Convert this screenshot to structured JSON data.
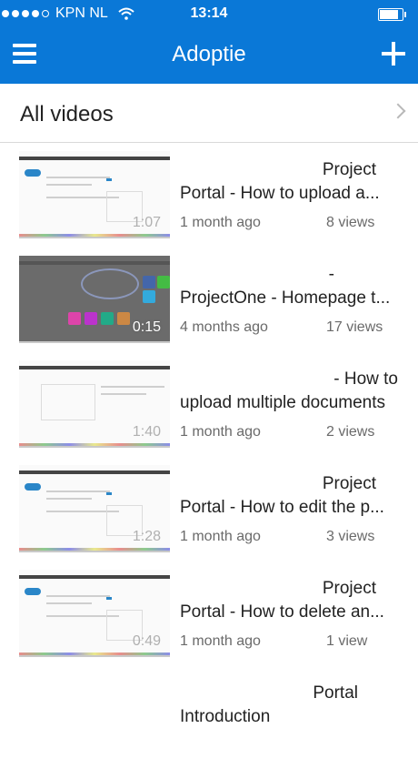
{
  "status": {
    "carrier": "KPN NL",
    "time": "13:14",
    "signal_icon": "signal-dots-icon",
    "wifi_icon": "wifi-icon",
    "battery_icon": "battery-icon"
  },
  "header": {
    "title": "Adoptie",
    "menu_icon": "hamburger-icon",
    "add_icon": "plus-icon",
    "color": "#0a78d7"
  },
  "section": {
    "label": "All videos",
    "chevron_icon": "chevron-right-icon"
  },
  "videos": [
    {
      "title_line1": "Project",
      "title_line2": "Portal - How to upload a...",
      "age": "1 month ago",
      "views": "8 views",
      "duration": "1:07"
    },
    {
      "title_line1": "-",
      "title_line2": "ProjectOne - Homepage t...",
      "age": "4 months ago",
      "views": "17 views",
      "duration": "0:15"
    },
    {
      "title_line1": "- How to",
      "title_line2": "upload multiple documents",
      "age": "1 month ago",
      "views": "2 views",
      "duration": "1:40"
    },
    {
      "title_line1": "Project",
      "title_line2": "Portal - How to edit the p...",
      "age": "1 month ago",
      "views": "3 views",
      "duration": "1:28"
    },
    {
      "title_line1": "Project",
      "title_line2": "Portal - How to delete an...",
      "age": "1 month ago",
      "views": "1 view",
      "duration": "0:49"
    },
    {
      "title_line1": "Portal",
      "title_line2": "Introduction",
      "age": "",
      "views": "",
      "duration": ""
    }
  ]
}
